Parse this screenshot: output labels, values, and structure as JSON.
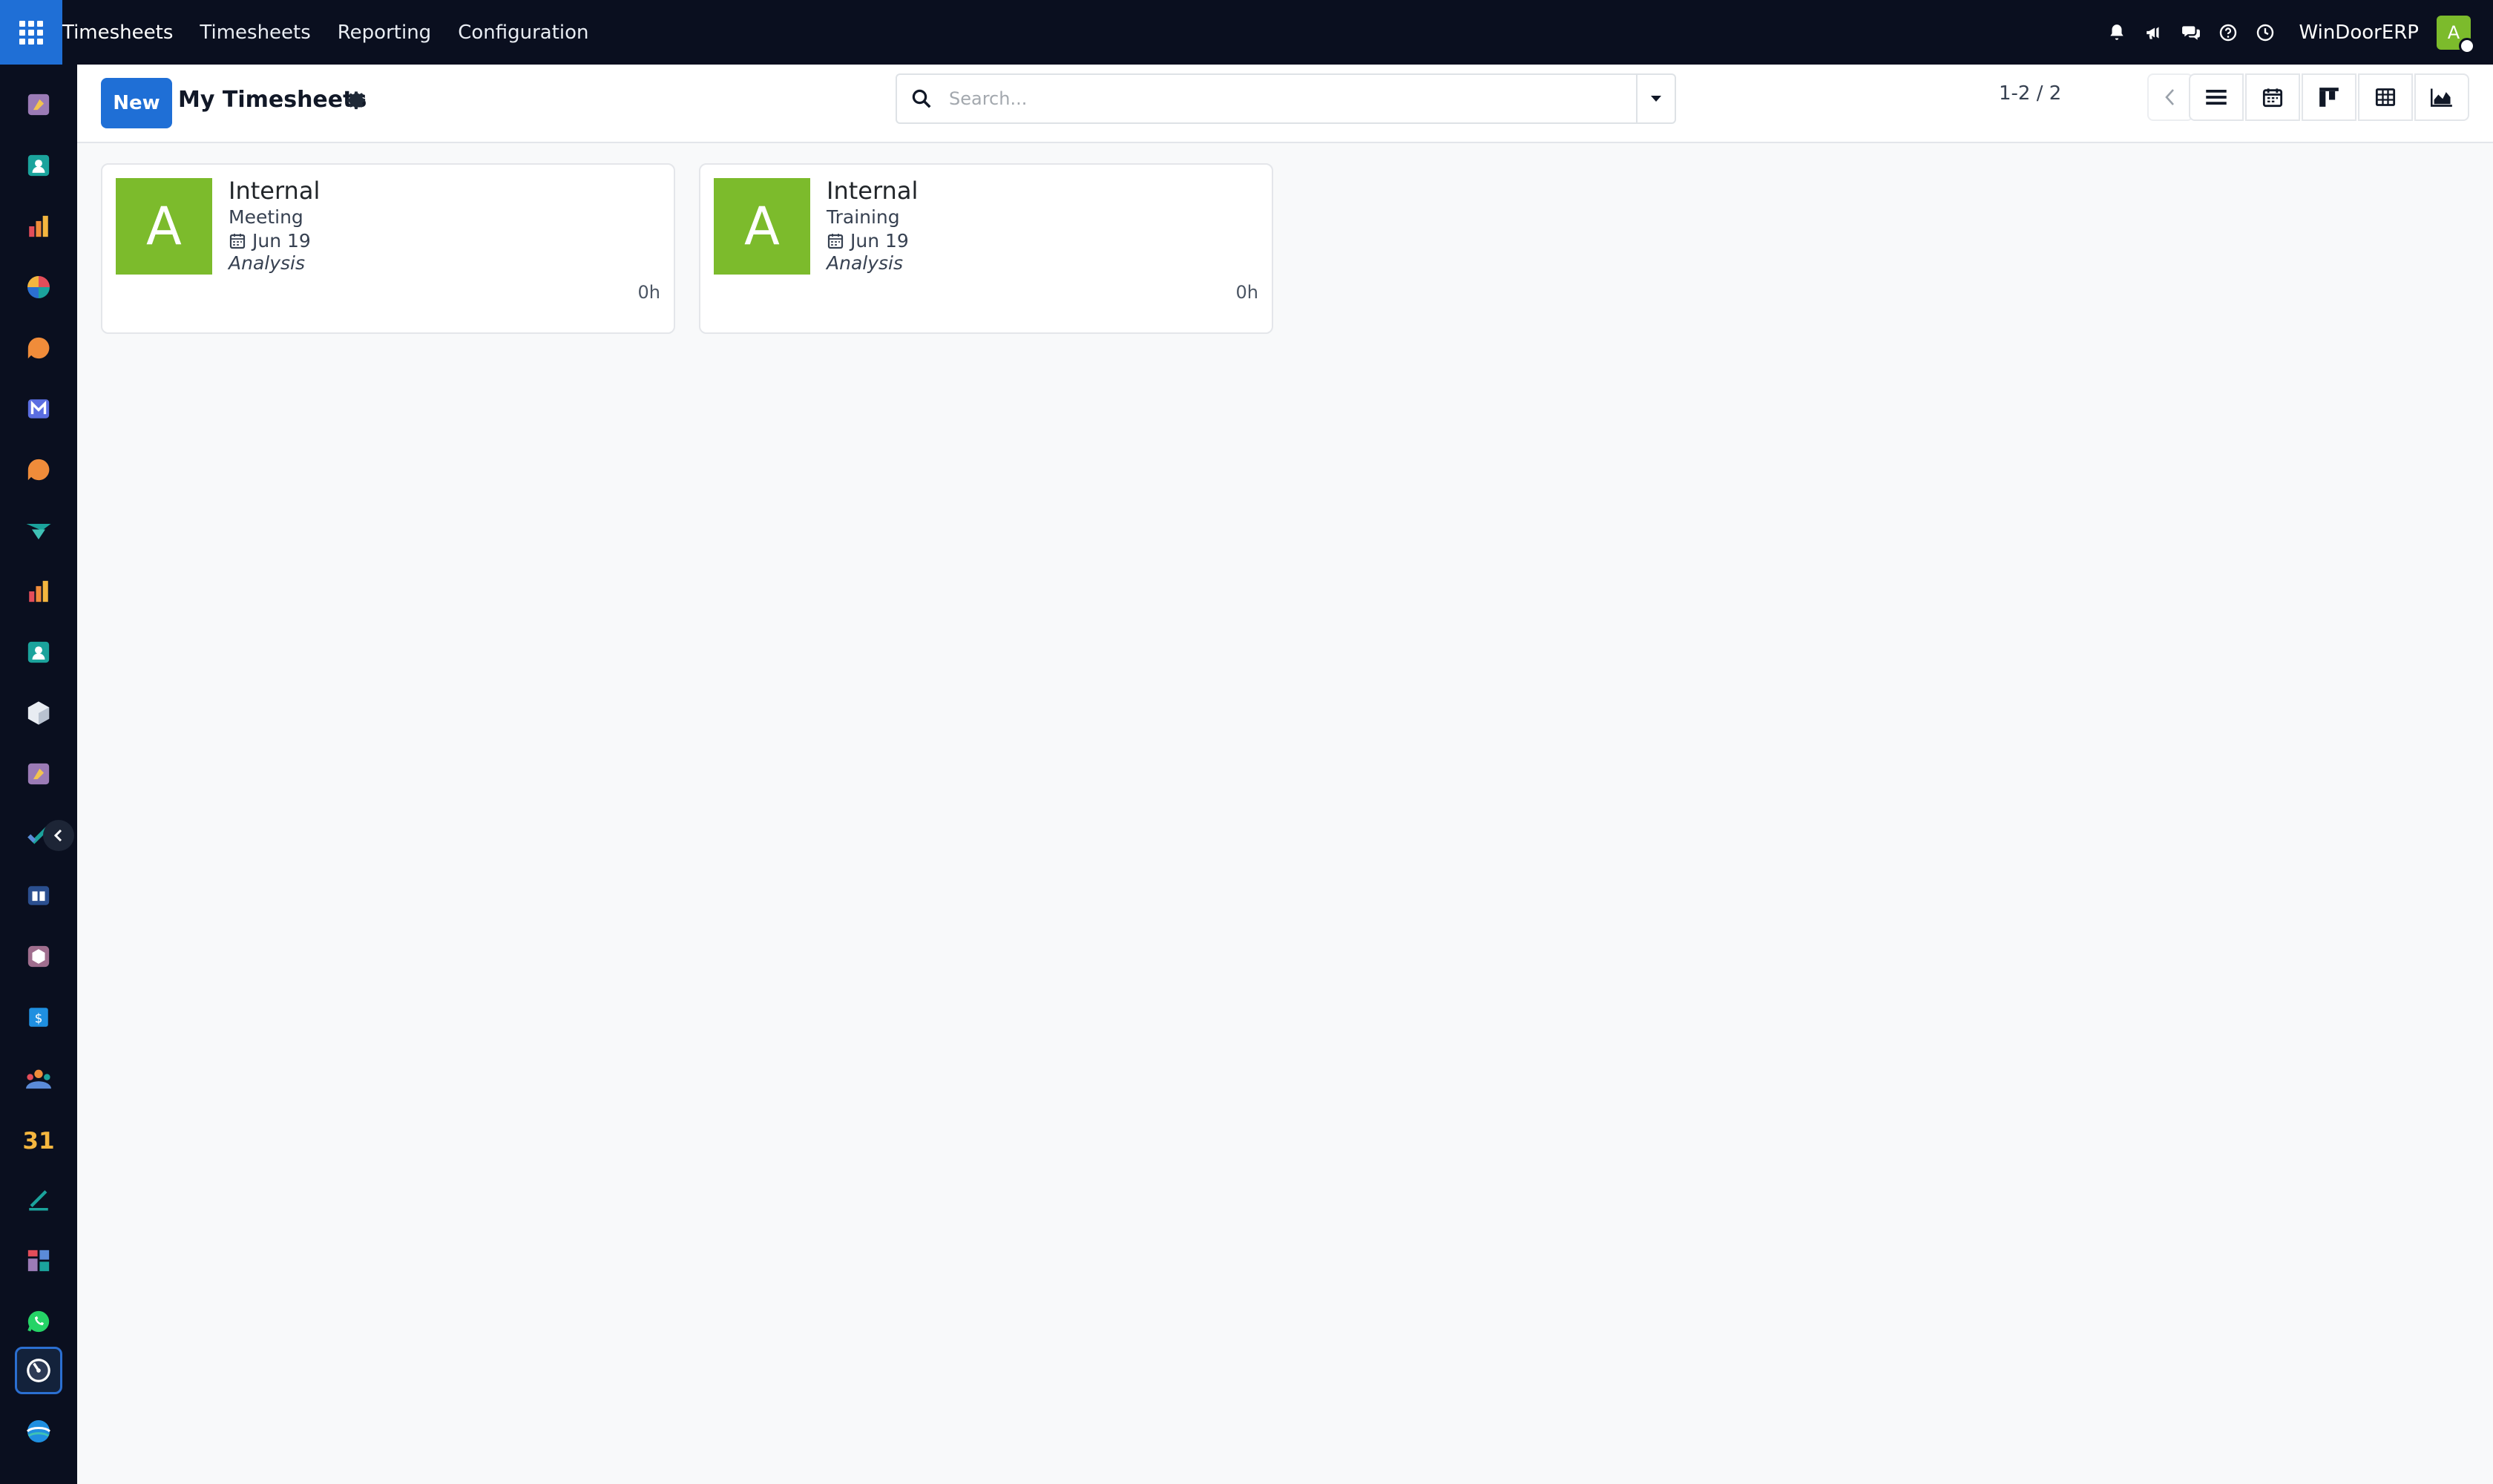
{
  "topbar": {
    "brand": "Timesheets",
    "menu": [
      "Timesheets",
      "Reporting",
      "Configuration"
    ],
    "company": "WinDoorERP",
    "user_initial": "A"
  },
  "control": {
    "new_label": "New",
    "title": "My Timesheets",
    "search_placeholder": "Search...",
    "pager": "1-2 / 2"
  },
  "cards": [
    {
      "initial": "A",
      "project": "Internal",
      "task": "Meeting",
      "date": "Jun 19",
      "tag": "Analysis",
      "hours": "0h"
    },
    {
      "initial": "A",
      "project": "Internal",
      "task": "Training",
      "date": "Jun 19",
      "tag": "Analysis",
      "hours": "0h"
    }
  ],
  "colors": {
    "topbar_bg": "#0a0f1f",
    "primary": "#1f6fd6",
    "avatar_green": "#7cbb2c",
    "background": "#f8f9fa"
  },
  "sidebar_icons": [
    "knowledge-icon",
    "contacts-icon",
    "sales-icon",
    "crm-icon",
    "discuss-icon",
    "email-marketing-icon",
    "livechat-icon",
    "planning-icon",
    "reporting-icon",
    "employees-icon",
    "inventory-icon",
    "documents-icon",
    "project-icon",
    "elearning-icon",
    "product-icon",
    "invoicing-icon",
    "team-icon",
    "calendar-icon",
    "sign-icon",
    "dashboards-icon",
    "whatsapp-icon",
    "timesheets-icon",
    "helpdesk-icon"
  ]
}
